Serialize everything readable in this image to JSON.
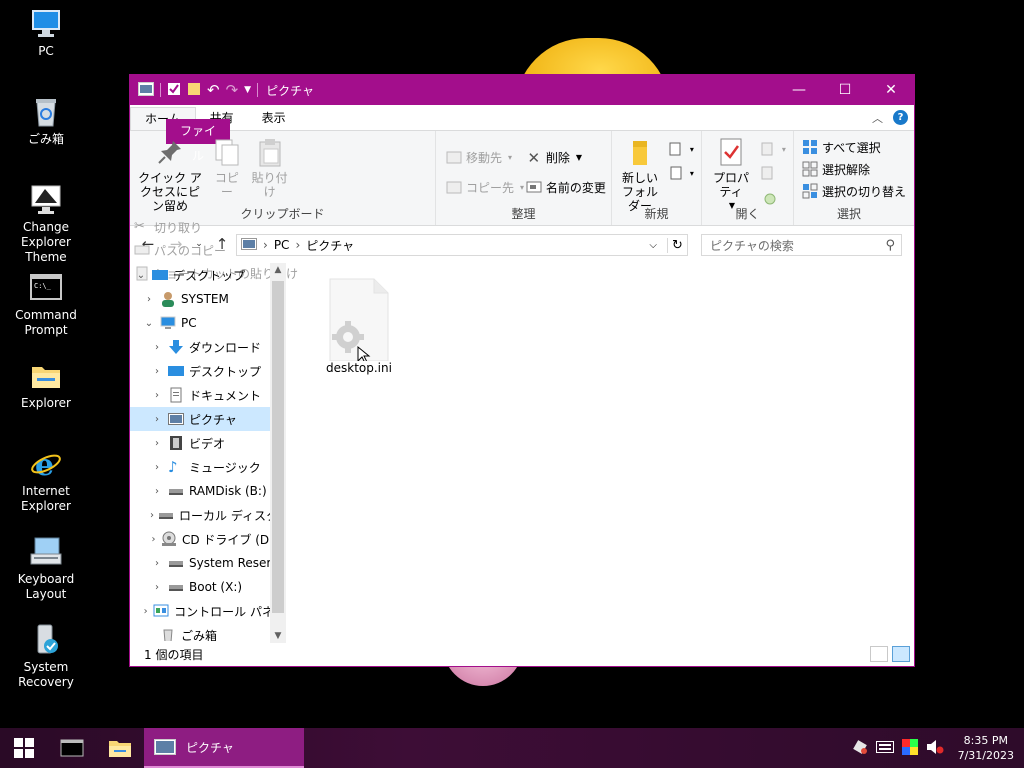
{
  "desktop": {
    "icons": [
      {
        "label": "PC",
        "icon": "pc-icon"
      },
      {
        "label": "ごみ箱",
        "icon": "recycle-bin-icon"
      },
      {
        "label": "Change Explorer Theme",
        "icon": "monitor-icon"
      },
      {
        "label": "Command Prompt",
        "icon": "cmd-icon"
      },
      {
        "label": "Explorer",
        "icon": "folder-icon"
      },
      {
        "label": "Internet Explorer",
        "icon": "ie-icon"
      },
      {
        "label": "Keyboard Layout",
        "icon": "keyboard-icon"
      },
      {
        "label": "System Recovery",
        "icon": "recovery-icon"
      }
    ]
  },
  "window": {
    "title": "ピクチャ",
    "tabs": {
      "file": "ファイル",
      "home": "ホーム",
      "share": "共有",
      "view": "表示"
    },
    "ribbon": {
      "clipboard": {
        "name": "クリップボード",
        "pin": "クイック アクセスにピン留め",
        "copy": "コピー",
        "paste": "貼り付け",
        "cut": "切り取り",
        "copy_path": "パスのコピー",
        "paste_shortcut": "ショートカットの貼り付け"
      },
      "organize": {
        "name": "整理",
        "move_to": "移動先",
        "copy_to": "コピー先",
        "delete": "削除",
        "rename": "名前の変更"
      },
      "new": {
        "name": "新規",
        "new_folder": "新しいフォルダー"
      },
      "open": {
        "name": "開く",
        "properties": "プロパティ"
      },
      "select": {
        "name": "選択",
        "select_all": "すべて選択",
        "select_none": "選択解除",
        "invert": "選択の切り替え"
      }
    },
    "address": {
      "segments": [
        "PC",
        "ピクチャ"
      ],
      "search_placeholder": "ピクチャの検索"
    },
    "tree": [
      {
        "label": "デスクトップ",
        "level": 0,
        "expanded": true
      },
      {
        "label": "SYSTEM",
        "level": 1
      },
      {
        "label": "PC",
        "level": 1,
        "expanded": true
      },
      {
        "label": "ダウンロード",
        "level": 2
      },
      {
        "label": "デスクトップ",
        "level": 2
      },
      {
        "label": "ドキュメント",
        "level": 2
      },
      {
        "label": "ピクチャ",
        "level": 2,
        "selected": true
      },
      {
        "label": "ビデオ",
        "level": 2
      },
      {
        "label": "ミュージック",
        "level": 2
      },
      {
        "label": "RAMDisk (B:)",
        "level": 2
      },
      {
        "label": "ローカル ディスク (",
        "level": 2
      },
      {
        "label": "CD ドライブ (D:) -",
        "level": 2
      },
      {
        "label": "System Reserve",
        "level": 2
      },
      {
        "label": "Boot (X:)",
        "level": 2
      },
      {
        "label": "コントロール パネル",
        "level": 1
      },
      {
        "label": "ごみ箱",
        "level": 1
      }
    ],
    "files": [
      {
        "name": "desktop.ini"
      }
    ],
    "status": "1 個の項目"
  },
  "taskbar": {
    "active_task": "ピクチャ",
    "time": "8:35 PM",
    "date": "7/31/2023"
  },
  "colors": {
    "accent": "#a30e8c",
    "selection": "#cce8ff"
  }
}
